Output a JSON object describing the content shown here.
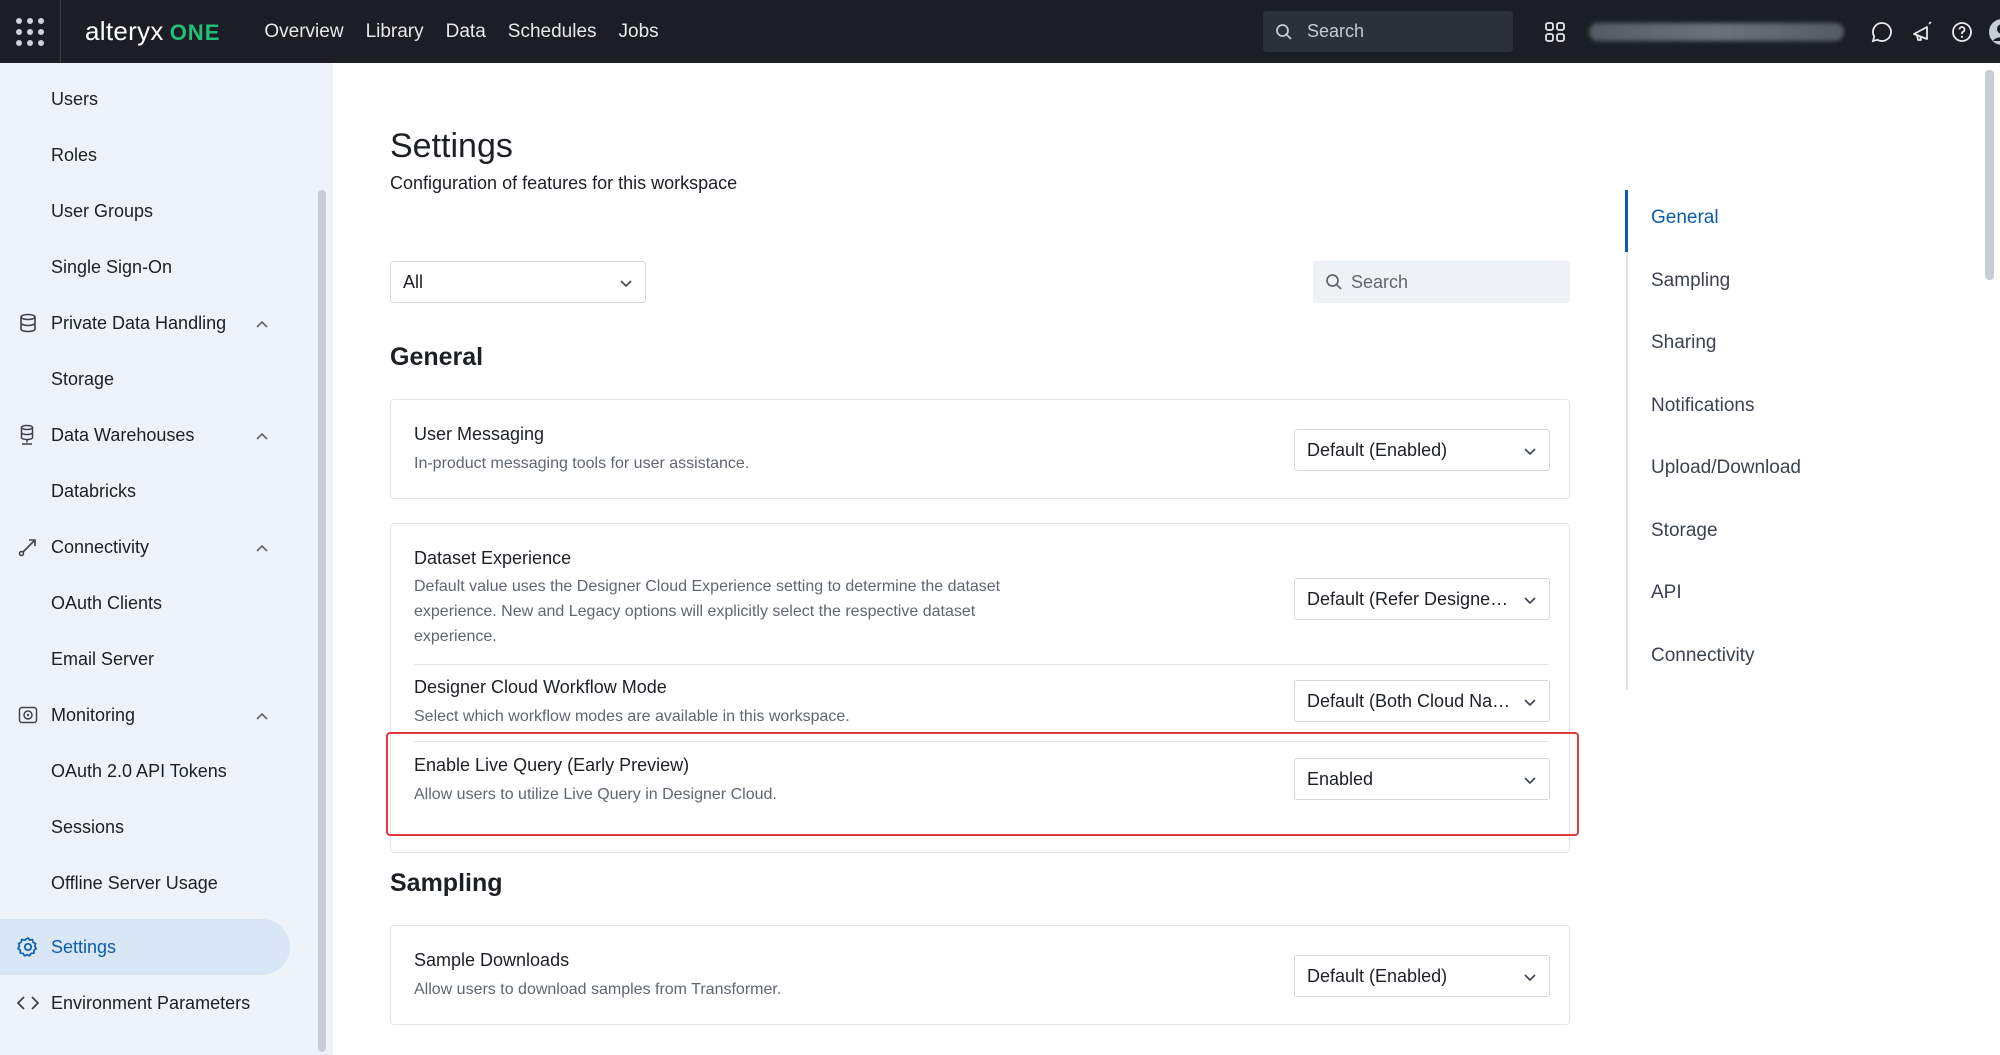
{
  "topbar": {
    "logo_text": "alteryx",
    "logo_one": "ONE",
    "nav": [
      "Overview",
      "Library",
      "Data",
      "Schedules",
      "Jobs"
    ],
    "search_placeholder": "Search"
  },
  "sidebar": {
    "items": [
      {
        "label": "Users",
        "icon": ""
      },
      {
        "label": "Roles",
        "icon": ""
      },
      {
        "label": "User Groups",
        "icon": ""
      },
      {
        "label": "Single Sign-On",
        "icon": ""
      },
      {
        "label": "Private Data Handling",
        "icon": "database-icon",
        "expandable": true
      },
      {
        "label": "Storage",
        "icon": ""
      },
      {
        "label": "Data Warehouses",
        "icon": "warehouse-icon",
        "expandable": true
      },
      {
        "label": "Databricks",
        "icon": ""
      },
      {
        "label": "Connectivity",
        "icon": "connectivity-icon",
        "expandable": true
      },
      {
        "label": "OAuth Clients",
        "icon": ""
      },
      {
        "label": "Email Server",
        "icon": ""
      },
      {
        "label": "Monitoring",
        "icon": "monitoring-icon",
        "expandable": true
      },
      {
        "label": "OAuth 2.0 API Tokens",
        "icon": ""
      },
      {
        "label": "Sessions",
        "icon": ""
      },
      {
        "label": "Offline Server Usage",
        "icon": ""
      },
      {
        "label": "Settings",
        "icon": "gear-icon",
        "active": true
      },
      {
        "label": "Environment Parameters",
        "icon": "code-icon"
      }
    ]
  },
  "main": {
    "title": "Settings",
    "subtitle": "Configuration of features for this workspace",
    "filter_value": "All",
    "search_placeholder": "Search",
    "sections": [
      {
        "heading": "General",
        "cards": [
          {
            "rows": [
              {
                "title": "User Messaging",
                "desc": "In-product messaging tools for user assistance.",
                "value": "Default (Enabled)"
              }
            ]
          },
          {
            "rows": [
              {
                "title": "Dataset Experience",
                "desc": "Default value uses the Designer Cloud Experience setting to determine the dataset experience. New and Legacy options will explicitly select the respective dataset experience.",
                "value": "Default (Refer Designer Cloud Experience)"
              },
              {
                "title": "Designer Cloud Workflow Mode",
                "desc": "Select which workflow modes are available in this workspace.",
                "value": "Default (Both Cloud Native and Classic)"
              },
              {
                "title": "Enable Live Query (Early Preview)",
                "desc": "Allow users to utilize Live Query in Designer Cloud.",
                "value": "Enabled"
              }
            ]
          }
        ]
      },
      {
        "heading": "Sampling",
        "cards": [
          {
            "rows": [
              {
                "title": "Sample Downloads",
                "desc": "Allow users to download samples from Transformer.",
                "value": "Default (Enabled)"
              }
            ]
          }
        ]
      }
    ]
  },
  "toc": {
    "items": [
      "General",
      "Sampling",
      "Sharing",
      "Notifications",
      "Upload/Download",
      "Storage",
      "API",
      "Connectivity"
    ],
    "active": "General"
  },
  "colors": {
    "topbar": "#1b1f25",
    "accent": "#0b5cad",
    "sidebar_bg": "#eef3fa",
    "highlight": "#e03a3a",
    "brand_one": "#21c07a"
  }
}
